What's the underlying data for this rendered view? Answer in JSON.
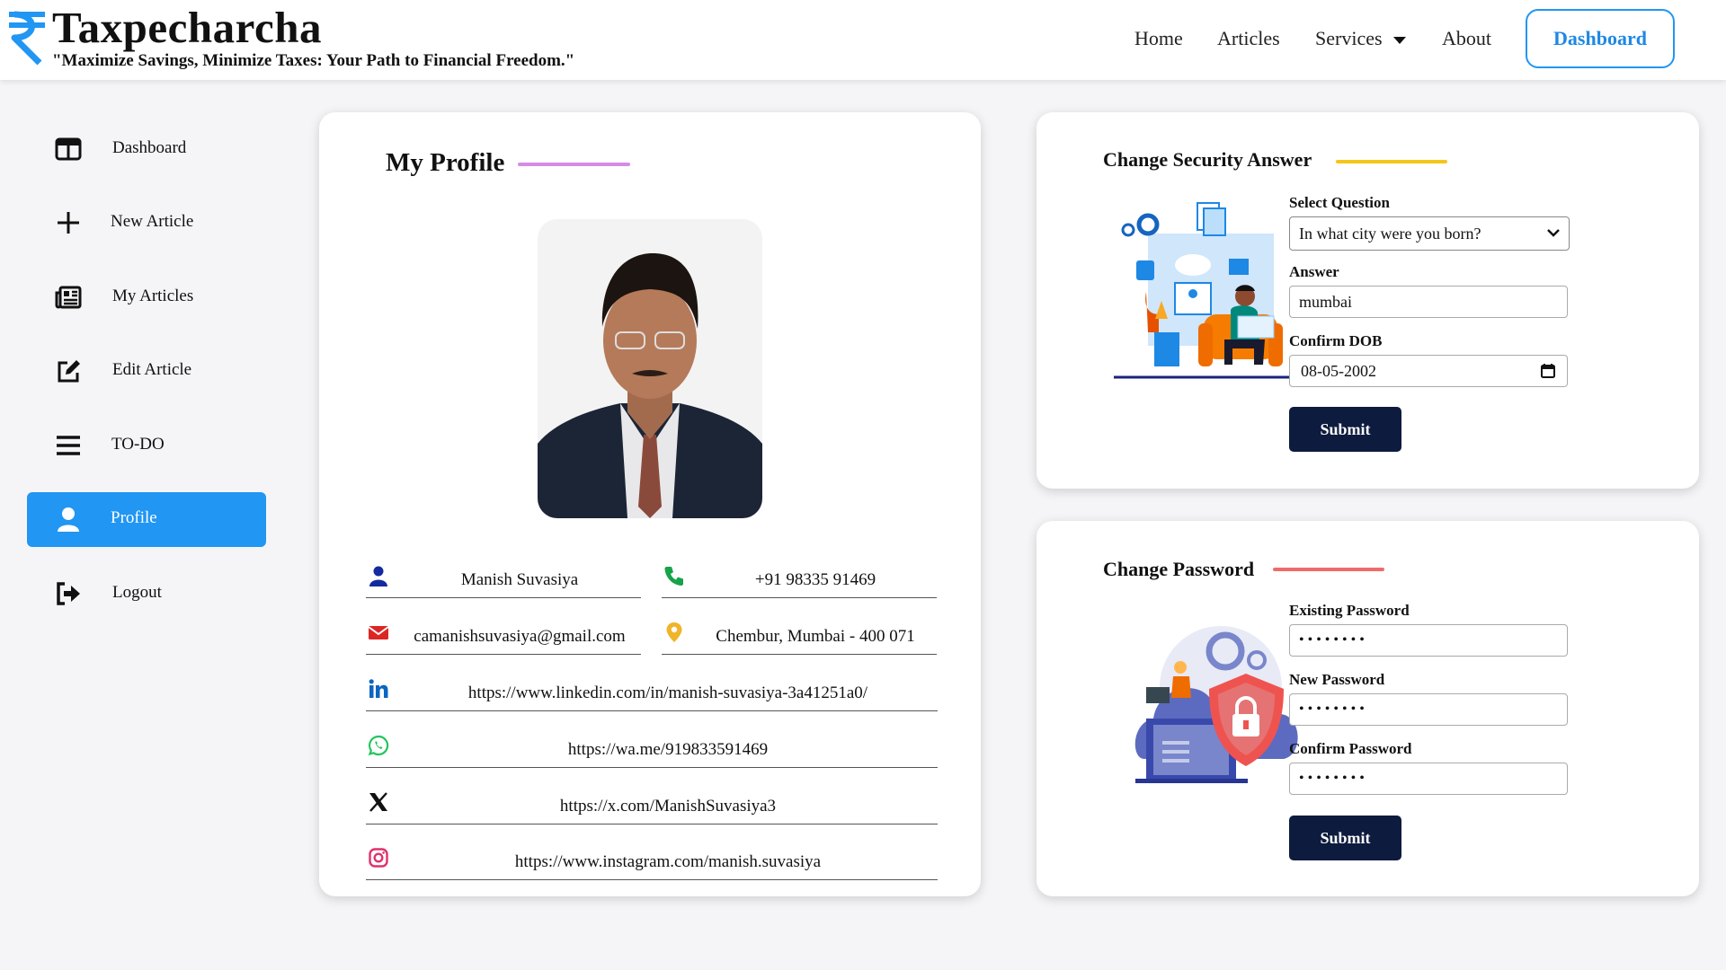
{
  "header": {
    "brand": "Taxpecharcha",
    "tagline": "\"Maximize Savings, Minimize Taxes: Your Path to Financial Freedom.\"",
    "nav": [
      "Home",
      "Articles",
      "Services",
      "About"
    ],
    "dashboard_button": "Dashboard",
    "brand_color": "#2196f3"
  },
  "sidebar": {
    "items": [
      {
        "label": "Dashboard",
        "icon": "layout-icon"
      },
      {
        "label": "New Article",
        "icon": "plus-icon"
      },
      {
        "label": "My Articles",
        "icon": "newspaper-icon"
      },
      {
        "label": "Edit Article",
        "icon": "edit-icon"
      },
      {
        "label": "TO-DO",
        "icon": "menu-icon"
      },
      {
        "label": "Profile",
        "icon": "user-icon",
        "active": true
      },
      {
        "label": "Logout",
        "icon": "logout-icon"
      }
    ]
  },
  "profile": {
    "title": "My Profile",
    "name": "Manish Suvasiya",
    "phone": "+91 98335 91469",
    "email": "camanishsuvasiya@gmail.com",
    "location": "Chembur, Mumbai - 400 071",
    "linkedin": "https://www.linkedin.com/in/manish-suvasiya-3a41251a0/",
    "whatsapp": "https://wa.me/919833591469",
    "x": "https://x.com/ManishSuvasiya3",
    "instagram": "https://www.instagram.com/manish.suvasiya"
  },
  "security": {
    "title": "Change Security Answer",
    "question_label": "Select Question",
    "question_value": "In what city were you born?",
    "answer_label": "Answer",
    "answer_value": "mumbai",
    "dob_label": "Confirm DOB",
    "dob_value": "08-05-2002",
    "submit": "Submit"
  },
  "password": {
    "title": "Change Password",
    "existing_label": "Existing Password",
    "new_label": "New Password",
    "confirm_label": "Confirm Password",
    "masked": "••••••••",
    "submit": "Submit"
  }
}
